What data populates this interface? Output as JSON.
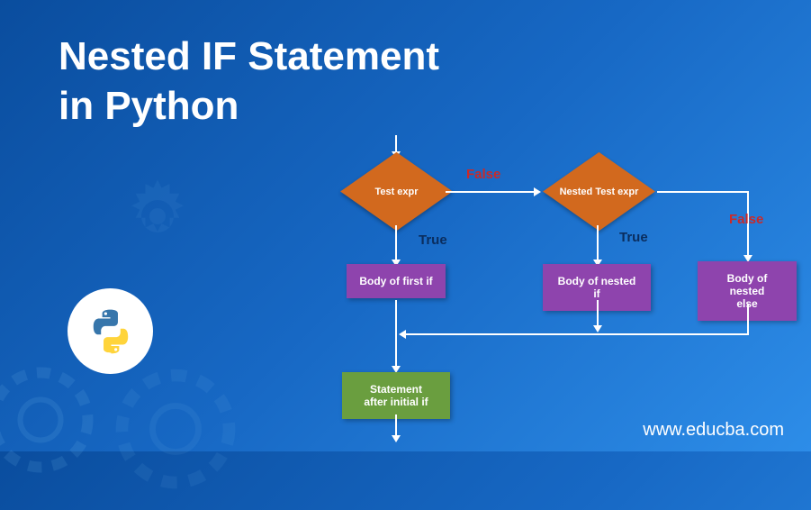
{
  "title_line1": "Nested IF Statement",
  "title_line2": "in Python",
  "website": "www.educba.com",
  "flowchart": {
    "diamond1": "Test expr",
    "diamond2": "Nested Test  expr",
    "box1": "Body of first if",
    "box2": "Body of nested if",
    "box3_line1": "Body of nested",
    "box3_line2": "else",
    "box4_line1": "Statement",
    "box4_line2": "after initial if",
    "label_true": "True",
    "label_false": "False"
  }
}
